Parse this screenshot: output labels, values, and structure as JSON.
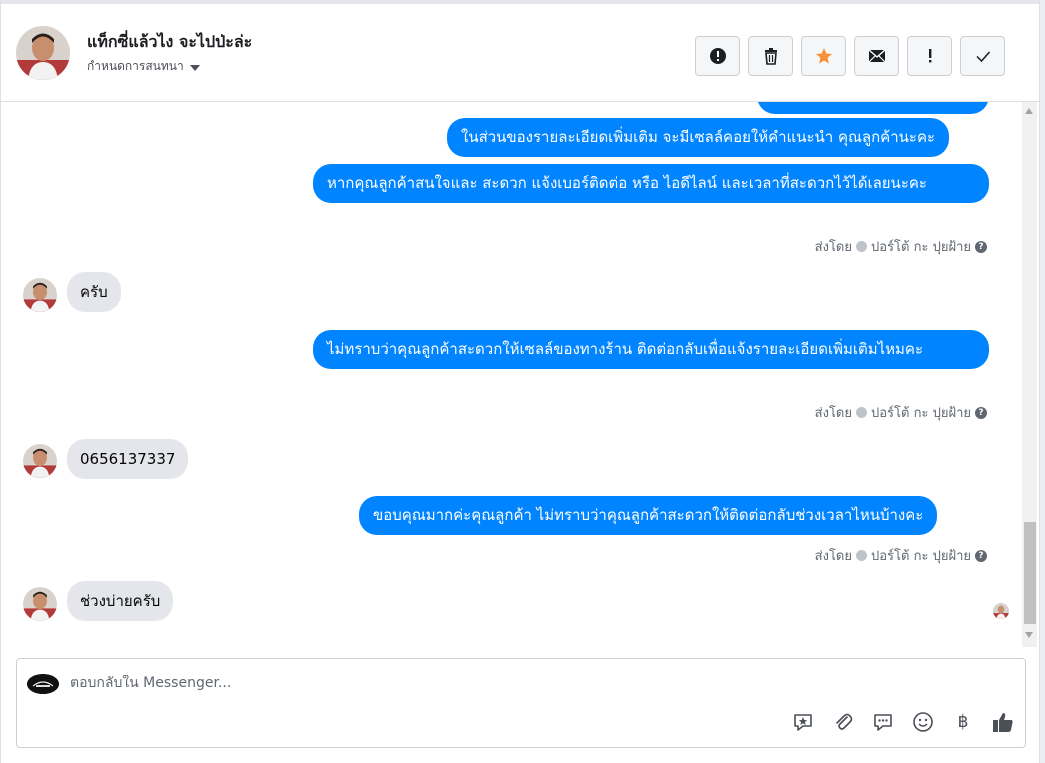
{
  "header": {
    "contact_name": "แท็กซี่แล้วไง จะไปป่ะล่ะ",
    "assign_label": "กำหนดการสนทนา",
    "actions": [
      {
        "name": "report-spam-button",
        "icon": "alert-circle-icon"
      },
      {
        "name": "delete-button",
        "icon": "trash-icon"
      },
      {
        "name": "star-button",
        "icon": "star-icon"
      },
      {
        "name": "mark-unread-button",
        "icon": "envelope-icon"
      },
      {
        "name": "follow-up-button",
        "icon": "exclamation-icon"
      },
      {
        "name": "mark-done-button",
        "icon": "check-icon"
      }
    ],
    "colors": {
      "star": "#f7923b"
    }
  },
  "messages": [
    {
      "from": "page",
      "text": "ในส่วนของรายละเอียดเพิ่มเติม จะมีเซลล์คอยให้คำแนะนำ คุณลูกค้านะคะ"
    },
    {
      "from": "page",
      "text": "หากคุณลูกค้าสนใจและ สะดวก แจ้งเบอร์ติดต่อ หรือ ไอดีไลน์ และเวลาที่สะดวกไว้ได้เลยนะคะ"
    },
    {
      "from": "customer",
      "text": "ครับ"
    },
    {
      "from": "page",
      "text": "ไม่ทราบว่าคุณลูกค้าสะดวกให้เซลล์ของทางร้าน ติดต่อกลับเพื่อแจ้งรายละเอียดเพิ่มเติมไหมคะ"
    },
    {
      "from": "customer",
      "text": "0656137337"
    },
    {
      "from": "page",
      "text": "ขอบคุณมากค่ะคุณลูกค้า ไม่ทราบว่าคุณลูกค้าสะดวกให้ติดต่อกลับช่วงเวลาไหนบ้างคะ"
    },
    {
      "from": "customer",
      "text": "ช่วงบ่ายครับ"
    }
  ],
  "sent_by": {
    "prefix": "ส่งโดย",
    "agent": "ปอร์โต้ กะ ปุยฝ้าย"
  },
  "composer": {
    "placeholder": "ตอบกลับใน Messenger...",
    "tools": [
      "sticker-icon",
      "attachment-icon",
      "saved-replies-icon",
      "emoji-icon",
      "payment-baht-icon",
      "like-icon"
    ],
    "baht_symbol": "฿"
  },
  "colors": {
    "outgoing_bubble": "#0084ff",
    "incoming_bubble": "#e4e6eb"
  }
}
